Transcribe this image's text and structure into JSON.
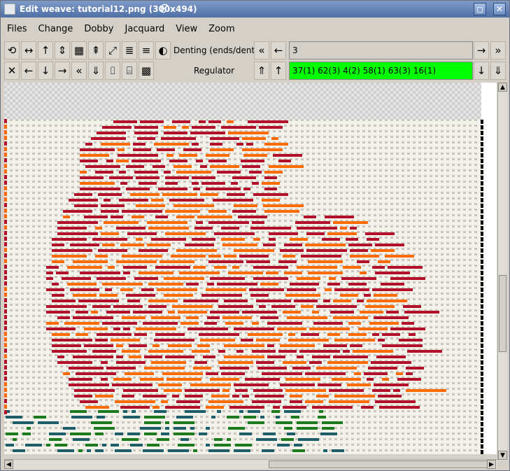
{
  "window": {
    "title": "Edit weave: tutorial12.png (300x494)",
    "maximize_glyph": "◻",
    "close_glyph": "✕"
  },
  "menubar": {
    "items": [
      "Files",
      "Change",
      "Dobby",
      "Jacquard",
      "View",
      "Zoom"
    ]
  },
  "toolbar_row1": {
    "tools": [
      "⟲",
      "↔",
      "↑",
      "⇕",
      "▦",
      "⇞",
      "⤢",
      "≣",
      "≡",
      "◐"
    ],
    "tool_names": [
      "rotate-icon",
      "flip-horizontal-icon",
      "arrow-up-icon",
      "move-vertical-icon",
      "invert-grid-icon",
      "double-arrow-up-icon",
      "scale-icon",
      "stairs-right-icon",
      "stairs-left-icon",
      "half-tone-icon"
    ],
    "denting_label": "Denting (ends/dent)",
    "denting_value": "3",
    "first_glyph": "«",
    "prev_glyph": "←",
    "next_glyph": "→",
    "last_glyph": "»"
  },
  "toolbar_row2": {
    "tools": [
      "✕",
      "←",
      "↓",
      "→",
      "«",
      "⇓",
      "⌷",
      "⌸",
      "▩"
    ],
    "tool_names": [
      "clear-icon",
      "arrow-left-icon",
      "arrow-down-icon",
      "arrow-right-icon",
      "double-arrow-left-icon",
      "double-arrow-down-icon",
      "stairs-up-icon",
      "stairs-down-icon",
      "checker-icon"
    ],
    "regulator_label": "Regulator",
    "regulator_value": "37(1) 62(3) 4(2) 58(1) 63(3) 16(1)",
    "first_glyph": "⇑",
    "prev_glyph": "↑",
    "next_glyph": "↓",
    "last_glyph": "⇓"
  },
  "colors": {
    "regulator_bg": "#00ff00",
    "thread_red": "#b3102a",
    "thread_orange": "#ff6a00",
    "thread_teal": "#1d5e6a",
    "thread_green": "#1e7a1e",
    "fabric_bg": "#f2f1ea"
  }
}
